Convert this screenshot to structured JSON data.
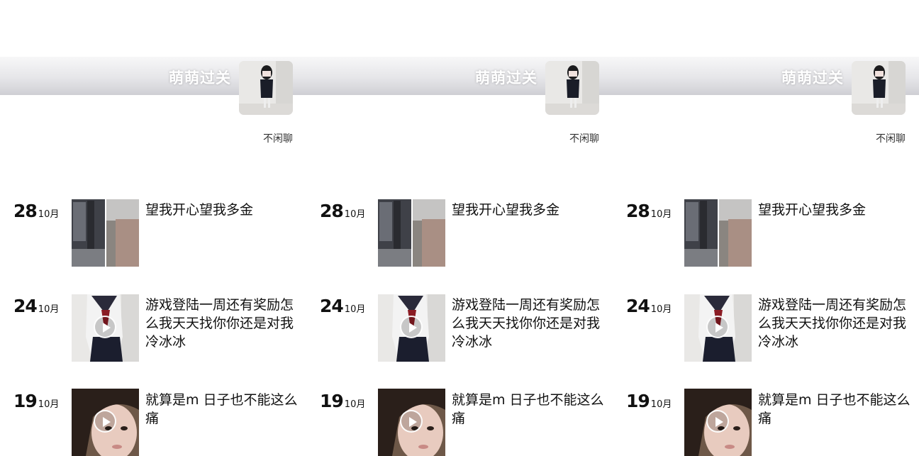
{
  "banner": {
    "title": "萌萌过关"
  },
  "profile": {
    "caption": "不闲聊"
  },
  "posts": [
    {
      "day": "28",
      "month": "10月",
      "text": "望我开心望我多金",
      "thumbnail": "photo-dark-room",
      "has_video": false
    },
    {
      "day": "24",
      "month": "10月",
      "text": "游戏登陆一周还有奖励怎么我天天找你你还是对我冷冰冰",
      "thumbnail": "photo-sailor-uniform",
      "has_video": true
    },
    {
      "day": "19",
      "month": "10月",
      "text": "就算是m 日子也不能这么痛",
      "thumbnail": "photo-girl-face",
      "has_video": true
    }
  ],
  "colors": {
    "background": "#ffffff",
    "banner_light": "#f7f7f8",
    "banner_dark": "#cfcfd4",
    "text": "#111111"
  }
}
